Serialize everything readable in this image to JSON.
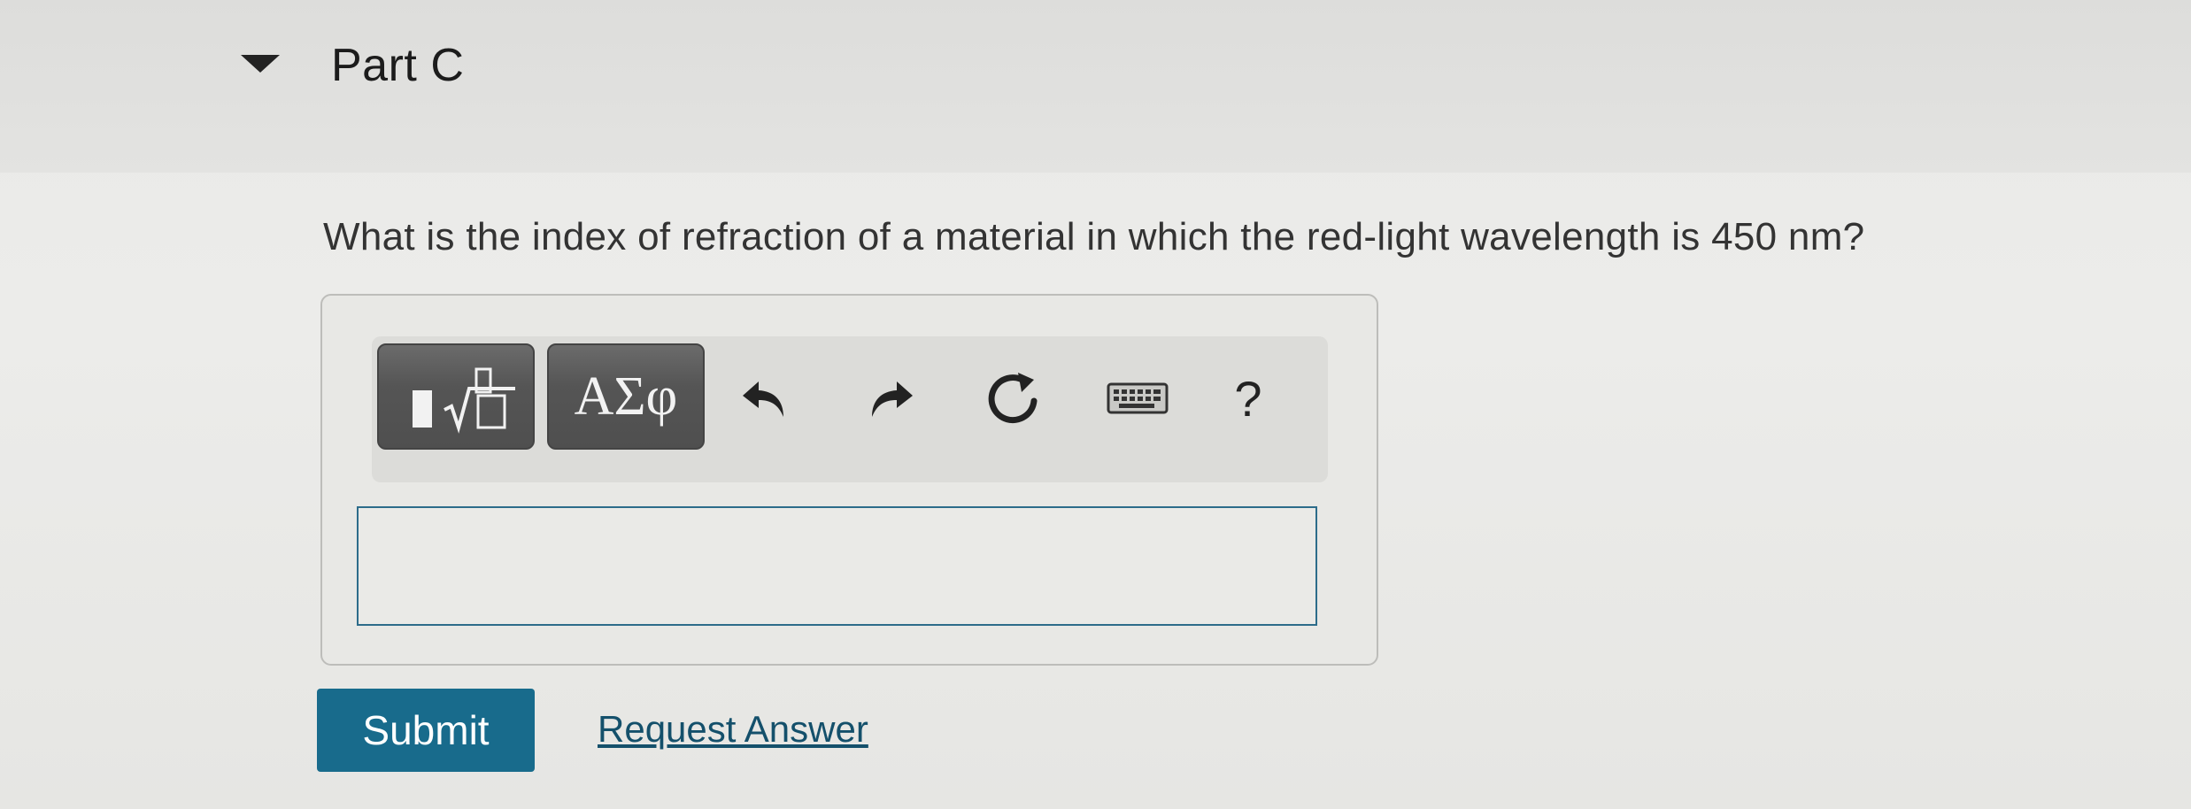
{
  "part": {
    "title": "Part C",
    "toggle_icon": "triangle-down-icon"
  },
  "question": {
    "text": "What is the index of refraction of a material in which the red-light wavelength is 450 nm?"
  },
  "toolbar": {
    "templates_icon": "fraction-sqrt-templates-icon",
    "symbols_label": "ΑΣφ",
    "undo_icon": "undo-icon",
    "redo_icon": "redo-icon",
    "reset_icon": "reset-icon",
    "keyboard_icon": "keyboard-icon",
    "help_label": "?"
  },
  "answer": {
    "value": ""
  },
  "actions": {
    "submit_label": "Submit",
    "request_answer_label": "Request Answer"
  },
  "colors": {
    "submit_bg": "#186b8c",
    "link": "#14506b",
    "input_border": "#2d6c8a"
  }
}
